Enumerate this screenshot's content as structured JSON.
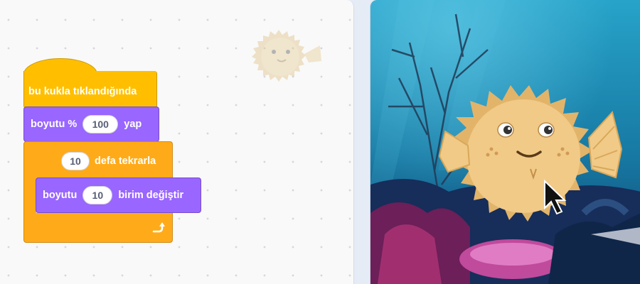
{
  "workspace": {
    "hat_block": {
      "label": "bu kukla tıklandığında"
    },
    "set_size_block": {
      "prefix": "boyutu %",
      "value": "100",
      "suffix": "yap"
    },
    "repeat_block": {
      "value": "10",
      "label": "defa tekrarla"
    },
    "change_size_block": {
      "prefix": "boyutu",
      "value": "10",
      "suffix": "birim değiştir"
    },
    "loop_arrow_icon": "loop-arrow-icon",
    "sprite_icon": "pufferfish-icon"
  },
  "stage": {
    "backdrop": "underwater-reef",
    "sprite": "pufferfish",
    "cursor": "mouse-pointer"
  },
  "colors": {
    "events": "#ffbf00",
    "looks": "#9966ff",
    "control": "#ffab19",
    "workspace_bg": "#f9f9f9"
  }
}
